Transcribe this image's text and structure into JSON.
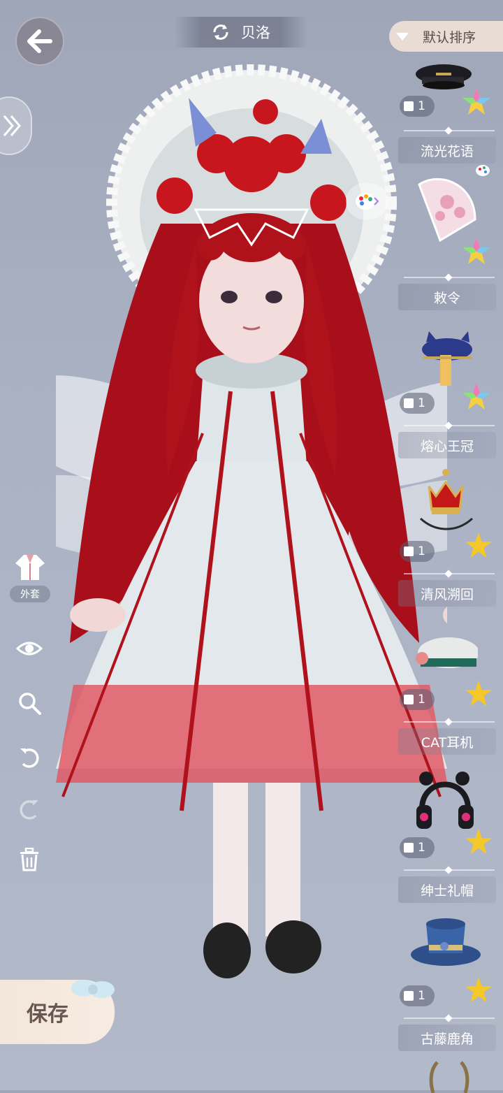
{
  "header": {
    "character_name": "贝洛",
    "sort_label": "默认排序"
  },
  "sidebar": {
    "outer_label": "外套"
  },
  "save_label": "保存",
  "items": [
    {
      "name": "",
      "count": "1",
      "star": "multi",
      "icon": "captain-hat-icon"
    },
    {
      "name": "流光花语",
      "count": "",
      "star": "multi",
      "icon": "lace-fan-icon"
    },
    {
      "name": "敕令",
      "count": "1",
      "star": "multi",
      "icon": "cat-ear-hat-icon"
    },
    {
      "name": "熔心王冠",
      "count": "1",
      "star": "gold",
      "icon": "crown-icon"
    },
    {
      "name": "清风溯回",
      "count": "1",
      "star": "gold",
      "icon": "green-beret-icon"
    },
    {
      "name": "CAT耳机",
      "count": "1",
      "star": "gold",
      "icon": "headphones-icon"
    },
    {
      "name": "绅士礼帽",
      "count": "1",
      "star": "gold",
      "icon": "top-hat-icon"
    },
    {
      "name": "古藤鹿角",
      "count": "",
      "star": "",
      "icon": "antlers-icon"
    }
  ],
  "colors": {
    "background": "#a8b0c2",
    "hair": "#b0121c",
    "dress": "#dfe6ea",
    "dress_hem": "#e05a66"
  }
}
